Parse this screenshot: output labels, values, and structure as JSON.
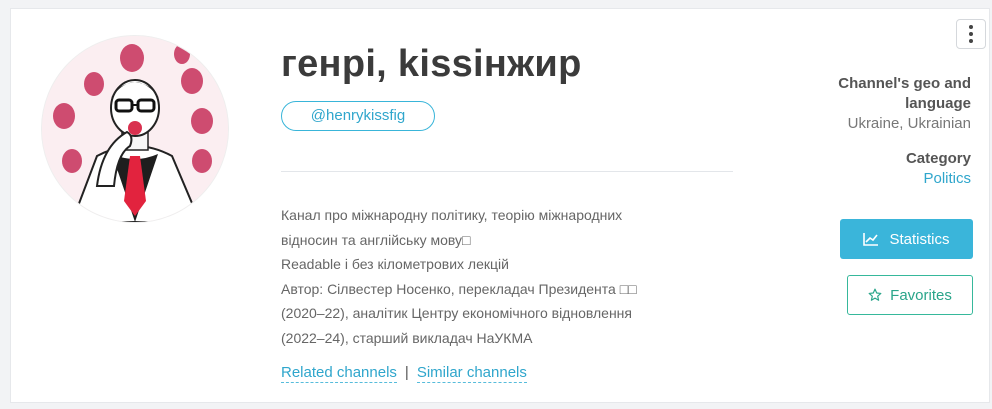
{
  "channel": {
    "title": "генрі, kissінжир",
    "handle": "@henrykissfig",
    "description_lines": [
      "Канал про міжнародну політику, теорію міжнародних",
      "відносин та англійську мову□",
      "Readable і без кілометрових лекцій",
      "Автор: Сілвестер Носенко, перекладач Президента □□",
      "(2020–22), аналітик Центру економічного відновлення",
      "(2022–24), старший викладач НаУКМА"
    ]
  },
  "links": {
    "related": "Related channels",
    "separator": "|",
    "similar": "Similar channels"
  },
  "meta": {
    "geo_label": "Channel's geo and language",
    "geo_value": "Ukraine, Ukrainian",
    "category_label": "Category",
    "category_value": "Politics"
  },
  "actions": {
    "statistics": "Statistics",
    "favorites": "Favorites"
  },
  "icons": {
    "menu": "more-vertical-icon",
    "statistics": "chart-icon",
    "favorites": "star-icon"
  },
  "colors": {
    "accent": "#3ab5da",
    "favorites": "#36b89b",
    "title": "#3b3b3b"
  }
}
